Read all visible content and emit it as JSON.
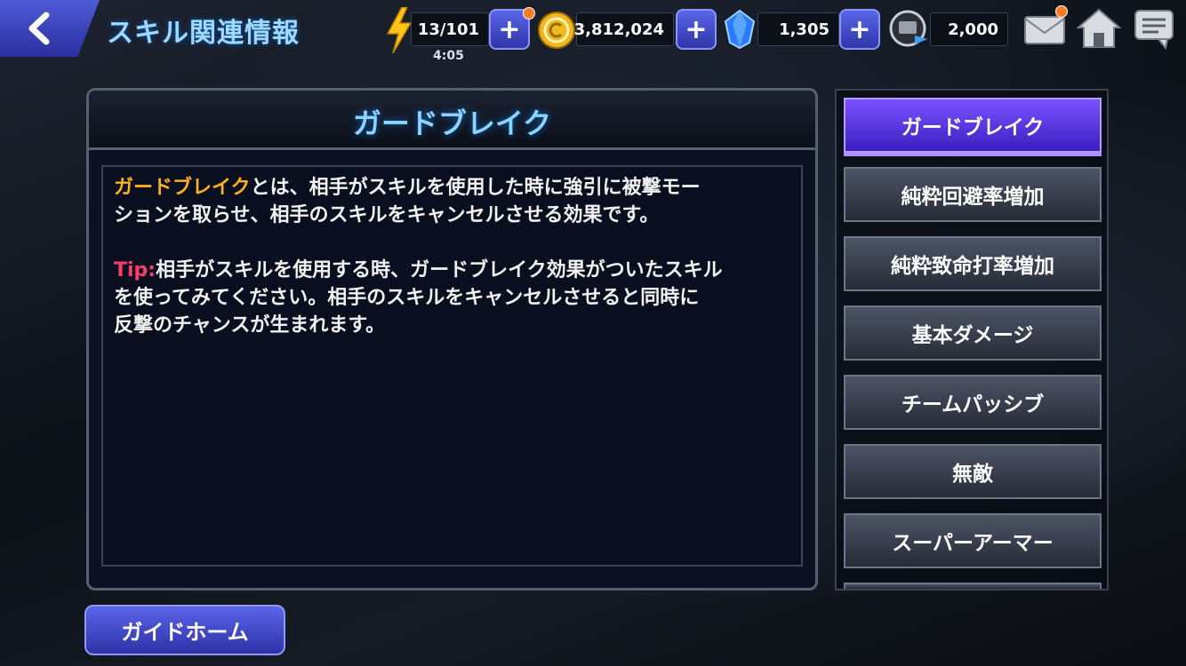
{
  "header": {
    "title": "スキル関連情報",
    "energy": "13/101",
    "energy_timer": "4:05",
    "gold": "3,812,024",
    "crystals": "1,305",
    "tickets": "2,000"
  },
  "panel": {
    "title": "ガードブレイク",
    "keyword": "ガードブレイク",
    "line1_rest": "とは、相手がスキルを使用した時に強引に被撃モー",
    "line2": "ションを取らせ、相手のスキルをキャンセルさせる効果です。",
    "tip_label": "Tip:",
    "tip_line1": "相手がスキルを使用する時、ガードブレイク効果がついたスキル",
    "tip_line2": "を使ってみてください。相手のスキルをキャンセルさせると同時に",
    "tip_line3": "反撃のチャンスが生まれます。"
  },
  "skill_list": [
    {
      "label": "ガードブレイク"
    },
    {
      "label": "純粋回避率増加"
    },
    {
      "label": "純粋致命打率増加"
    },
    {
      "label": "基本ダメージ"
    },
    {
      "label": "チームパッシブ"
    },
    {
      "label": "無敵"
    },
    {
      "label": "スーパーアーマー"
    }
  ],
  "footer": {
    "guide_home": "ガイドホーム"
  },
  "colors": {
    "keyword": "#ffb21f",
    "tip": "#ff3d6e",
    "active_item": "#5a35e0",
    "accent": "#4e5ad8"
  },
  "icons": [
    "back-arrow-icon",
    "lightning-icon",
    "gold-coin-icon",
    "crystal-icon",
    "ticket-icon",
    "mail-icon",
    "home-icon",
    "chat-icon"
  ]
}
